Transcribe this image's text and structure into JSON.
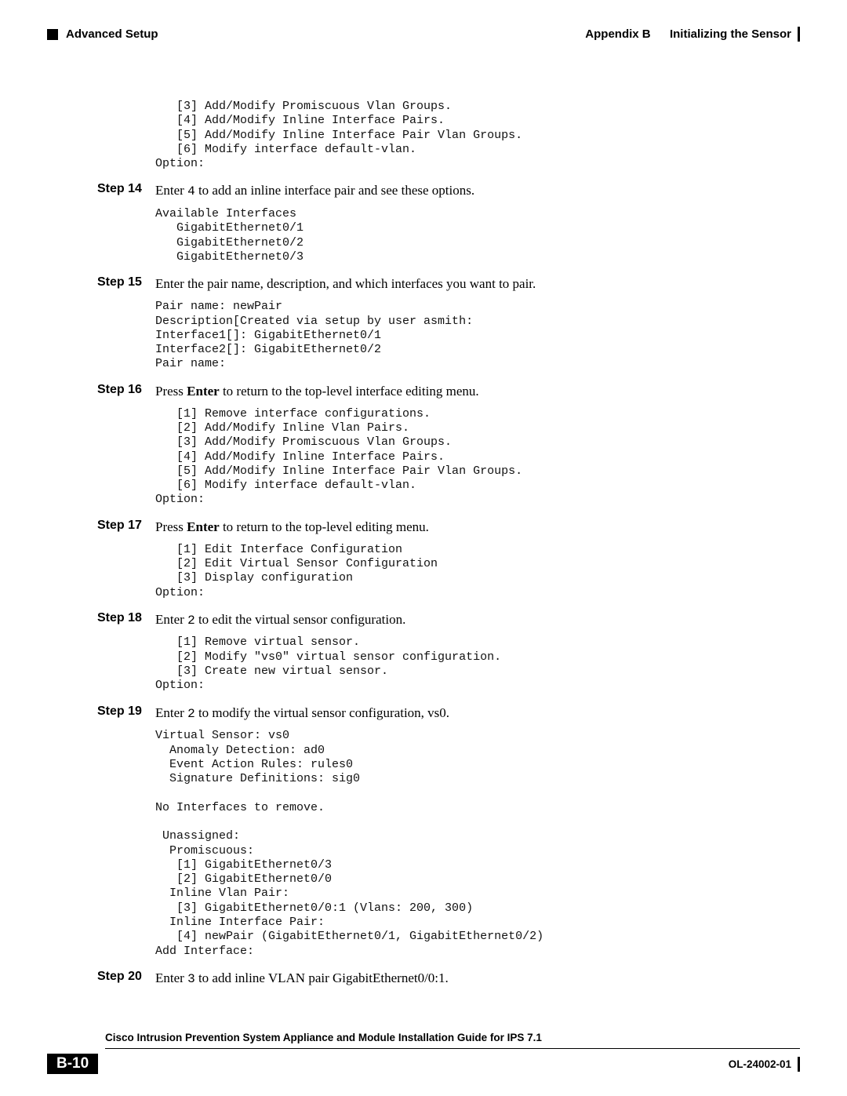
{
  "header": {
    "left": "Advanced Setup",
    "appendix_label": "Appendix B",
    "appendix_title": "Initializing the Sensor"
  },
  "code_top": "   [3] Add/Modify Promiscuous Vlan Groups.\n   [4] Add/Modify Inline Interface Pairs.\n   [5] Add/Modify Inline Interface Pair Vlan Groups.\n   [6] Modify interface default-vlan.\nOption:",
  "steps": {
    "s14": {
      "label": "Step 14",
      "text_pre": "Enter ",
      "cmd": "4",
      "text_post": " to add an inline interface pair and see these options.",
      "code": "Available Interfaces\n   GigabitEthernet0/1\n   GigabitEthernet0/2\n   GigabitEthernet0/3"
    },
    "s15": {
      "label": "Step 15",
      "text": "Enter the pair name, description, and which interfaces you want to pair.",
      "code": "Pair name: newPair\nDescription[Created via setup by user asmith:\nInterface1[]: GigabitEthernet0/1\nInterface2[]: GigabitEthernet0/2\nPair name:"
    },
    "s16": {
      "label": "Step 16",
      "text_pre": "Press ",
      "bold": "Enter",
      "text_post": " to return to the top-level interface editing menu.",
      "code": "   [1] Remove interface configurations.\n   [2] Add/Modify Inline Vlan Pairs.\n   [3] Add/Modify Promiscuous Vlan Groups.\n   [4] Add/Modify Inline Interface Pairs.\n   [5] Add/Modify Inline Interface Pair Vlan Groups.\n   [6] Modify interface default-vlan.\nOption:"
    },
    "s17": {
      "label": "Step 17",
      "text_pre": "Press ",
      "bold": "Enter",
      "text_post": " to return to the top-level editing menu.",
      "code": "   [1] Edit Interface Configuration\n   [2] Edit Virtual Sensor Configuration\n   [3] Display configuration\nOption:"
    },
    "s18": {
      "label": "Step 18",
      "text_pre": "Enter ",
      "cmd": "2",
      "text_post": " to edit the virtual sensor configuration.",
      "code": "   [1] Remove virtual sensor.\n   [2] Modify \"vs0\" virtual sensor configuration.\n   [3] Create new virtual sensor.\nOption:"
    },
    "s19": {
      "label": "Step 19",
      "text_pre": "Enter ",
      "cmd": "2",
      "text_post": " to modify the virtual sensor configuration, vs0.",
      "code": "Virtual Sensor: vs0\n  Anomaly Detection: ad0\n  Event Action Rules: rules0\n  Signature Definitions: sig0\n\nNo Interfaces to remove.\n\n Unassigned:\n  Promiscuous:\n   [1] GigabitEthernet0/3\n   [2] GigabitEthernet0/0\n  Inline Vlan Pair:\n   [3] GigabitEthernet0/0:1 (Vlans: 200, 300)\n  Inline Interface Pair:\n   [4] newPair (GigabitEthernet0/1, GigabitEthernet0/2)\nAdd Interface:"
    },
    "s20": {
      "label": "Step 20",
      "text_pre": "Enter ",
      "cmd": "3",
      "text_post": " to add inline VLAN pair GigabitEthernet0/0:1."
    }
  },
  "footer": {
    "title": "Cisco Intrusion Prevention System Appliance and Module Installation Guide for IPS 7.1",
    "page": "B-10",
    "doc_id": "OL-24002-01"
  }
}
